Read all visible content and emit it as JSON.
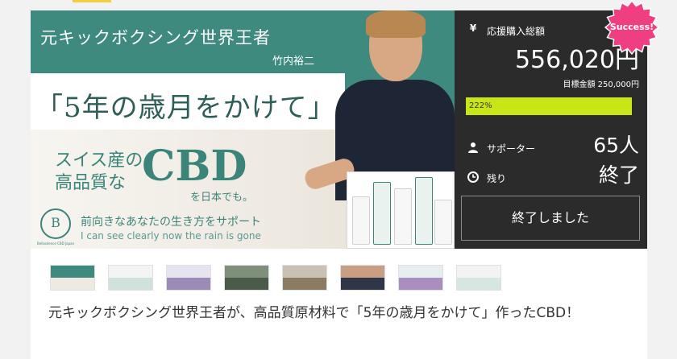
{
  "hero": {
    "title": "元キックボクシング世界王者",
    "name": "竹内裕二",
    "catch": "「5年の歳月をかけて」",
    "cbd_line1": "スイス産の",
    "cbd_line2": "高品質な",
    "cbd_big": "CBD",
    "cbd_japan": "を日本でも。",
    "logo_mark": "B",
    "logo_sub": "Bellasilence CBD Japan",
    "support_jp": "前向きなあなたの生き方をサポート",
    "support_en": "I can see clearly now the rain is gone"
  },
  "panel": {
    "total_label": "応援購入総額",
    "total_amount": "556,020円",
    "target": "目標金額 250,000円",
    "progress_text": "222%",
    "progress_fraction": 1.0,
    "supporters_label": "サポーター",
    "supporters_value": "65人",
    "remaining_label": "残り",
    "remaining_value": "終了",
    "ended_button": "終了しました",
    "success_badge": "Success!"
  },
  "colors": {
    "accent_green": "#3e8a7f",
    "progress": "#c8e616",
    "badge": "#f03e82",
    "panel_bg": "#2b2b2b"
  },
  "icons": {
    "total": "yen-icon",
    "supporters": "person-icon",
    "remaining": "clock-icon"
  },
  "project_title": "元キックボクシング世界王者が、高品質原材料で「5年の歳月をかけて」作ったCBD！"
}
